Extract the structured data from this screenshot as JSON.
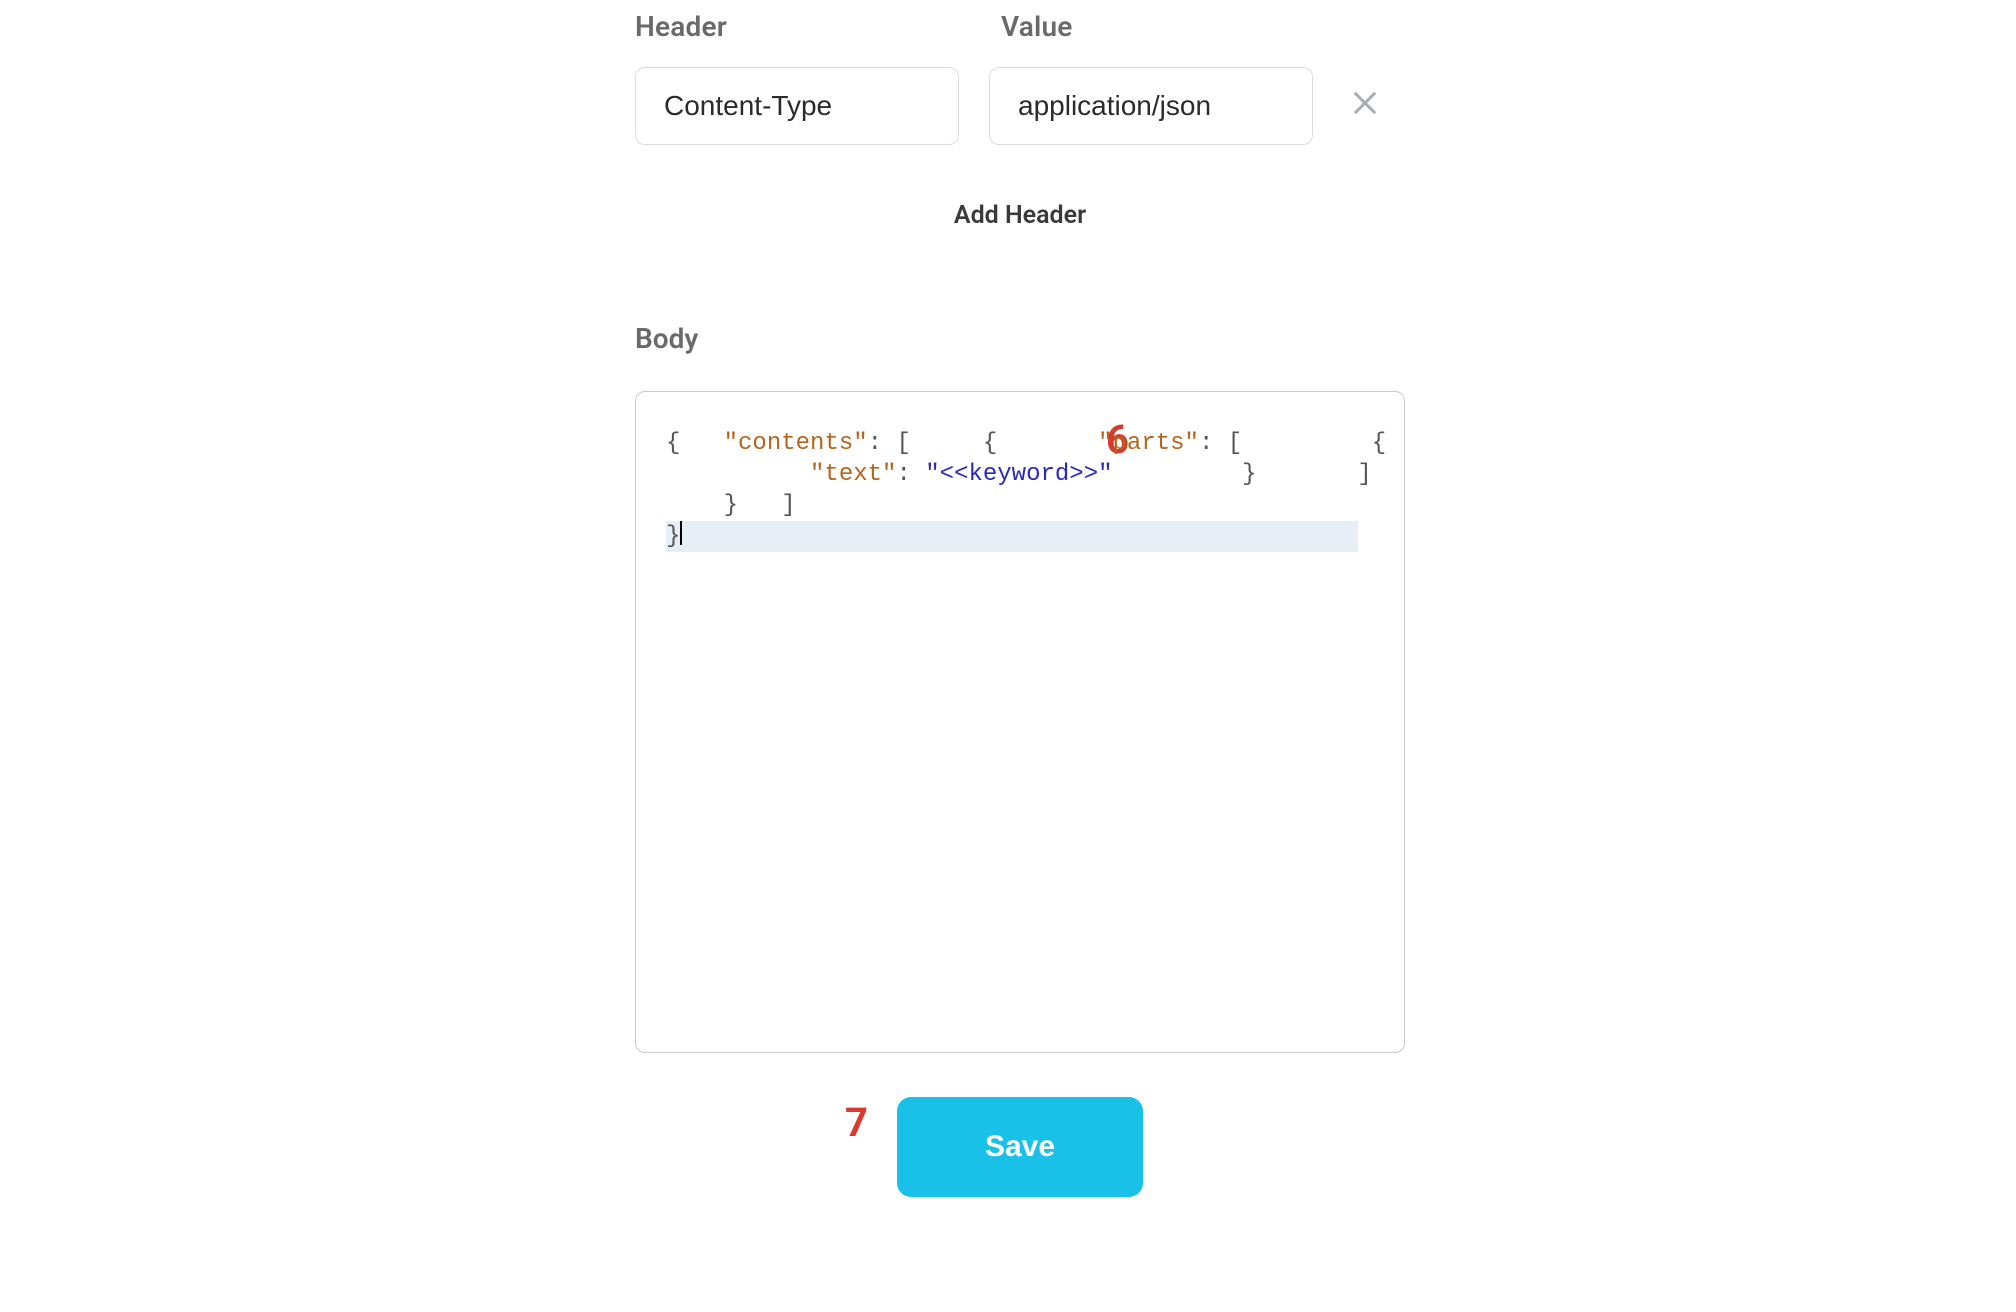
{
  "labels": {
    "header": "Header",
    "value": "Value",
    "add_header": "Add Header",
    "body": "Body",
    "save": "Save"
  },
  "headerRow": {
    "name": "Content-Type",
    "value": "application/json"
  },
  "annotations": {
    "six": "6",
    "seven": "7"
  },
  "code": {
    "l1_open": "{",
    "l2_key": "\"contents\"",
    "l2_after": ": [",
    "l3": "    {",
    "l4_key": "\"parts\"",
    "l4_after": ": [",
    "l5": "        {",
    "l6_key": "\"text\"",
    "l6_sep": ": ",
    "l6_val": "\"<<keyword>>\"",
    "l7": "        }",
    "l8": "      ]",
    "l9": "    }",
    "l10": "  ]",
    "l11": "}"
  }
}
